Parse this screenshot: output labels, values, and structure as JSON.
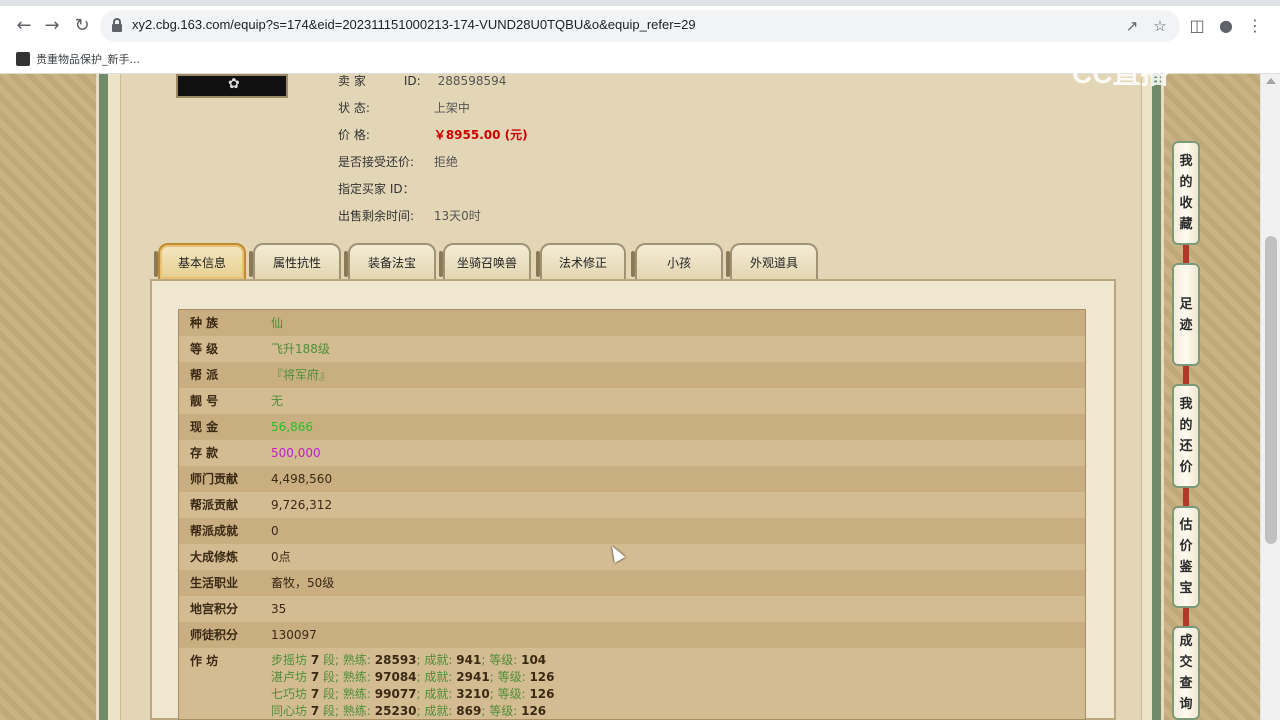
{
  "browser": {
    "url": "xy2.cbg.163.com/equip?s=174&eid=202311151000213-174-VUND28U0TQBU&o&equip_refer=29",
    "bookmark_label": "贵重物品保护_新手..."
  },
  "watermark": "CC直播",
  "seller": {
    "seller_label": "卖    家",
    "seller_id_label": "ID:",
    "seller_id": "288598594",
    "status_label": "状          态:",
    "status": "上架中",
    "price_label": "价          格:",
    "price": "￥8955.00 (元)",
    "counter_label": "是否接受还价:",
    "counter": "拒绝",
    "buyer_label": "指定买家 ID：",
    "time_label": "出售剩余时间:",
    "time": "13天0时"
  },
  "tabs": [
    "基本信息",
    "属性抗性",
    "装备法宝",
    "坐骑召唤兽",
    "法术修正",
    "小孩",
    "外观道具"
  ],
  "rows": [
    {
      "k": "种      族",
      "v": "仙"
    },
    {
      "k": "等      级",
      "v": "飞升188级"
    },
    {
      "k": "帮      派",
      "v": "『将军府』"
    },
    {
      "k": "靓      号",
      "v": "无"
    },
    {
      "k": "现      金",
      "v": "56,866"
    },
    {
      "k": "存      款",
      "v": "500,000"
    },
    {
      "k": "师门贡献",
      "v": "4,498,560"
    },
    {
      "k": "帮派贡献",
      "v": "9,726,312"
    },
    {
      "k": "帮派成就",
      "v": "0"
    },
    {
      "k": "大成修炼",
      "v": "0点"
    },
    {
      "k": "生活职业",
      "v": "畜牧，50级"
    },
    {
      "k": "地宫积分",
      "v": "35"
    },
    {
      "k": "师徒积分",
      "v": "130097"
    }
  ],
  "workshop": {
    "label": "作      坊",
    "lines": [
      {
        "name": "步摇坊",
        "seg": "7",
        "a": "28593",
        "b": "941",
        "c": "104"
      },
      {
        "name": "湛卢坊",
        "seg": "7",
        "a": "97084",
        "b": "2941",
        "c": "126"
      },
      {
        "name": "七巧坊",
        "seg": "7",
        "a": "99077",
        "b": "3210",
        "c": "126"
      },
      {
        "name": "同心坊",
        "seg": "7",
        "a": "25230",
        "b": "869",
        "c": "126"
      }
    ],
    "seg_label": "段;",
    "a_label": "熟练:",
    "b_label": "成就:",
    "c_label": "等级:",
    "sep": ";"
  },
  "sidebar": [
    {
      "label": "我的收藏"
    },
    {
      "label": "足迹"
    },
    {
      "label": "我的还价"
    },
    {
      "label": "估价鉴宝"
    },
    {
      "label": "成交查询"
    }
  ],
  "colors": {
    "price": "#cc0000",
    "cash": "#25c225",
    "deposit": "#c020c0",
    "value_green": "#4f8f3a"
  }
}
